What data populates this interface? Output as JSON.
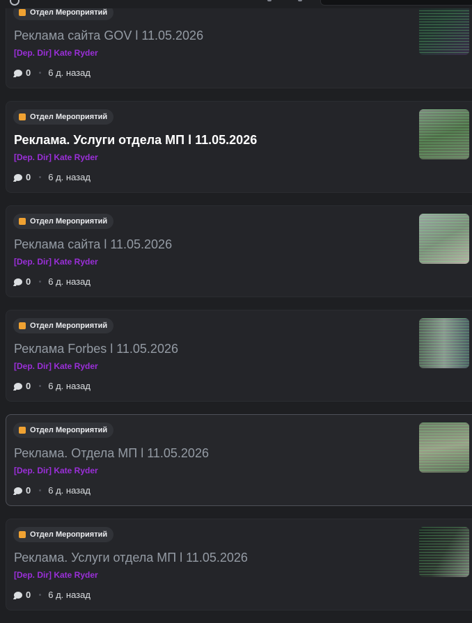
{
  "posts": [
    {
      "tag": "Отдел Мероприятий",
      "title": "Реклама сайта GOV l 11.05.2026",
      "author": "[Dep. Dir] Kate Ryder",
      "replies": "0",
      "time": "6 д. назад",
      "unread": false,
      "thumbnail": "screenshot-thumbnail"
    },
    {
      "tag": "Отдел Мероприятий",
      "title": "Реклама. Услуги отдела МП l 11.05.2026",
      "author": "[Dep. Dir] Kate Ryder",
      "replies": "0",
      "time": "6 д. назад",
      "unread": true,
      "thumbnail": "screenshot-thumbnail"
    },
    {
      "tag": "Отдел Мероприятий",
      "title": "Реклама сайта l 11.05.2026",
      "author": "[Dep. Dir] Kate Ryder",
      "replies": "0",
      "time": "6 д. назад",
      "unread": false,
      "thumbnail": "screenshot-thumbnail"
    },
    {
      "tag": "Отдел Мероприятий",
      "title": "Реклама Forbes l 11.05.2026",
      "author": "[Dep. Dir] Kate Ryder",
      "replies": "0",
      "time": "6 д. назад",
      "unread": false,
      "thumbnail": "screenshot-thumbnail"
    },
    {
      "tag": "Отдел Мероприятий",
      "title": "Реклама. Отдела МП l 11.05.2026",
      "author": "[Dep. Dir] Kate Ryder",
      "replies": "0",
      "time": "6 д. назад",
      "unread": false,
      "thumbnail": "screenshot-thumbnail"
    },
    {
      "tag": "Отдел Мероприятий",
      "title": "Реклама. Услуги отдела МП l 11.05.2026",
      "author": "[Dep. Dir] Kate Ryder",
      "replies": "0",
      "time": "6 д. назад",
      "unread": false,
      "thumbnail": "screenshot-thumbnail"
    }
  ],
  "colors": {
    "background": "#1e1f22",
    "card": "#242529",
    "tag_accent": "#f0a232",
    "author_role": "#9b2fd9",
    "title_read": "#949ba4",
    "title_unread": "#ffffff"
  },
  "icons": {
    "tag": "square-tag-icon",
    "replies": "speech-bubble-icon"
  }
}
